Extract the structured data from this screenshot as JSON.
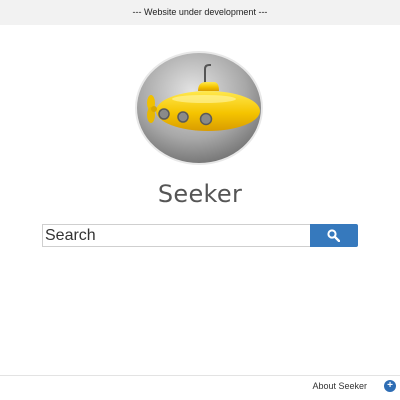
{
  "banner": {
    "text": "--- Website under development ---"
  },
  "logo": {
    "name": "yellow-submarine-logo"
  },
  "site": {
    "title": "Seeker"
  },
  "search": {
    "placeholder": "Search",
    "value": "",
    "button_icon": "search-icon"
  },
  "footer": {
    "about_label": "About Seeker",
    "expand_icon": "plus-icon"
  },
  "colors": {
    "accent": "#3679bd",
    "banner_bg": "#f2f2f2",
    "submarine": "#f5c400"
  }
}
